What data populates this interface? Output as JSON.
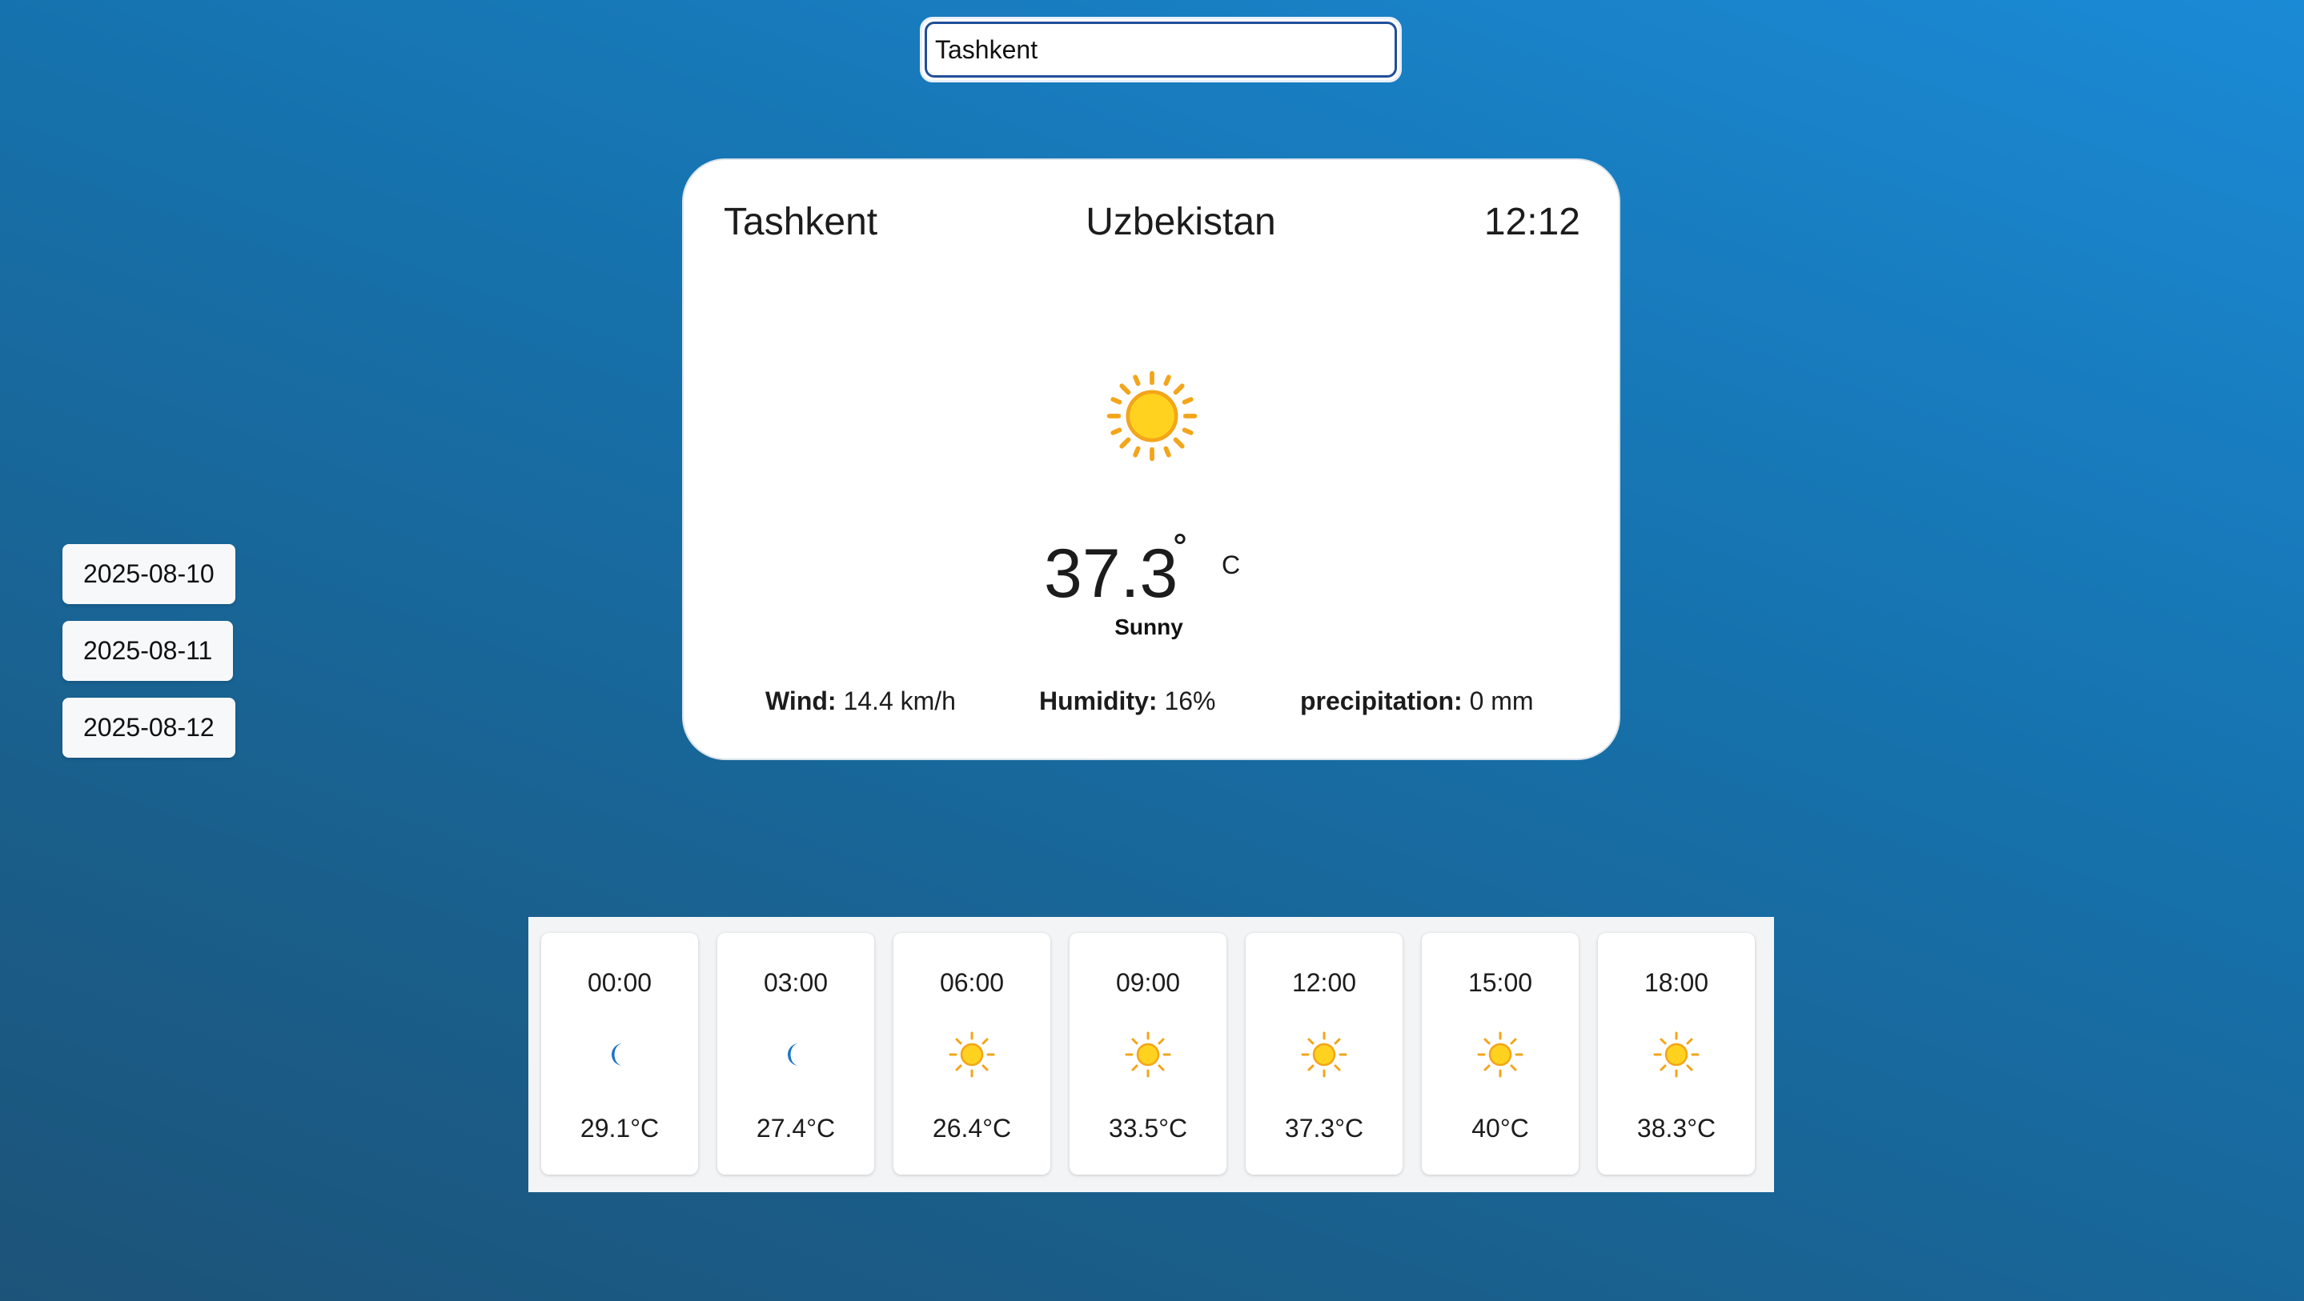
{
  "search": {
    "value": "Tashkent"
  },
  "dates": [
    "2025-08-10",
    "2025-08-11",
    "2025-08-12"
  ],
  "current": {
    "city": "Tashkent",
    "country": "Uzbekistan",
    "time": "12:12",
    "icon": "sun-icon",
    "temperature": "37.3",
    "degree_symbol": "˚",
    "unit": "C",
    "condition": "Sunny",
    "wind_label": "Wind:",
    "wind_value": "14.4 km/h",
    "humidity_label": "Humidity:",
    "humidity_value": "16%",
    "precipitation_label": "precipitation:",
    "precipitation_value": "0 mm"
  },
  "hourly": [
    {
      "time": "00:00",
      "icon": "moon-icon",
      "temp": "29.1°C"
    },
    {
      "time": "03:00",
      "icon": "moon-icon",
      "temp": "27.4°C"
    },
    {
      "time": "06:00",
      "icon": "sun-icon",
      "temp": "26.4°C"
    },
    {
      "time": "09:00",
      "icon": "sun-icon",
      "temp": "33.5°C"
    },
    {
      "time": "12:00",
      "icon": "sun-icon",
      "temp": "37.3°C"
    },
    {
      "time": "15:00",
      "icon": "sun-icon",
      "temp": "40°C"
    },
    {
      "time": "18:00",
      "icon": "sun-icon",
      "temp": "38.3°C"
    }
  ],
  "colors": {
    "sun_core": "#ffd21f",
    "sun_ring": "#f3a51b",
    "moon": "#1a73c7"
  }
}
